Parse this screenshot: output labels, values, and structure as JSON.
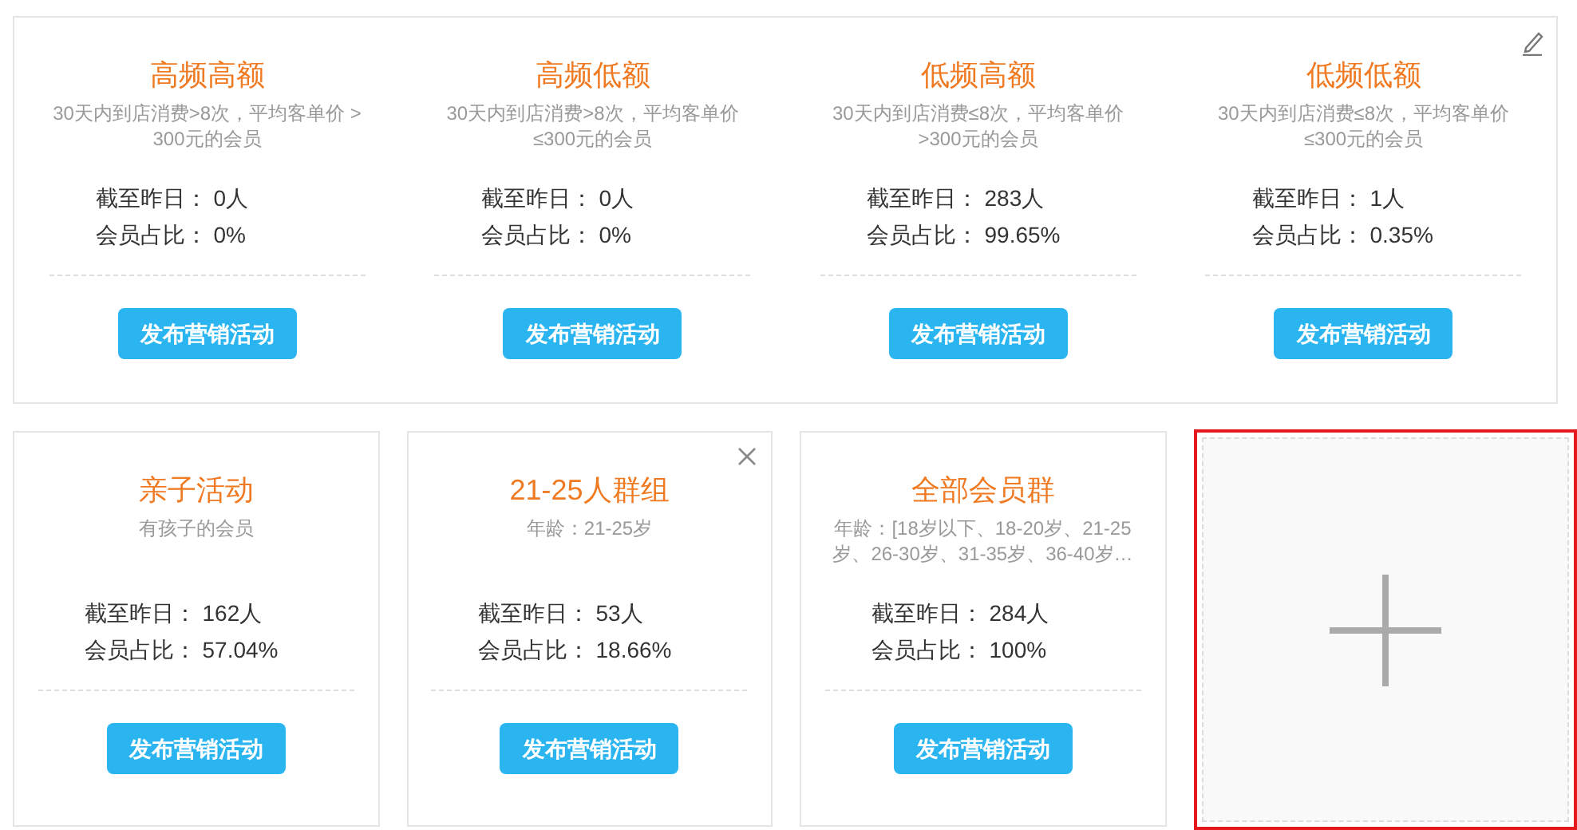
{
  "top_panel": {
    "editable": true,
    "segments": [
      {
        "title": "高频高额",
        "description": "30天内到店消费>8次，平均客单价 > 300元的会员",
        "stats": [
          {
            "label": "截至昨日：",
            "value": "0人"
          },
          {
            "label": "会员占比：",
            "value": "0%"
          }
        ],
        "button": "发布营销活动"
      },
      {
        "title": "高频低额",
        "description": "30天内到店消费>8次，平均客单价 ≤300元的会员",
        "stats": [
          {
            "label": "截至昨日：",
            "value": "0人"
          },
          {
            "label": "会员占比：",
            "value": "0%"
          }
        ],
        "button": "发布营销活动"
      },
      {
        "title": "低频高额",
        "description": "30天内到店消费≤8次，平均客单价 >300元的会员",
        "stats": [
          {
            "label": "截至昨日：",
            "value": "283人"
          },
          {
            "label": "会员占比：",
            "value": "99.65%"
          }
        ],
        "button": "发布营销活动"
      },
      {
        "title": "低频低额",
        "description": "30天内到店消费≤8次，平均客单价 ≤300元的会员",
        "stats": [
          {
            "label": "截至昨日：",
            "value": "1人"
          },
          {
            "label": "会员占比：",
            "value": "0.35%"
          }
        ],
        "button": "发布营销活动"
      }
    ]
  },
  "groups": [
    {
      "title": "亲子活动",
      "description": "有孩子的会员",
      "closable": false,
      "stats": [
        {
          "label": "截至昨日：",
          "value": "162人"
        },
        {
          "label": "会员占比：",
          "value": "57.04%"
        }
      ],
      "button": "发布营销活动"
    },
    {
      "title": "21-25人群组",
      "description": "年龄：21-25岁",
      "closable": true,
      "stats": [
        {
          "label": "截至昨日：",
          "value": "53人"
        },
        {
          "label": "会员占比：",
          "value": "18.66%"
        }
      ],
      "button": "发布营销活动"
    },
    {
      "title": "全部会员群",
      "description": "年龄：[18岁以下、18-20岁、21-25岁、26-30岁、31-35岁、36-40岁…",
      "closable": false,
      "stats": [
        {
          "label": "截至昨日：",
          "value": "284人"
        },
        {
          "label": "会员占比：",
          "value": "100%"
        }
      ],
      "button": "发布营销活动"
    }
  ],
  "add_card": {
    "selected": true
  }
}
